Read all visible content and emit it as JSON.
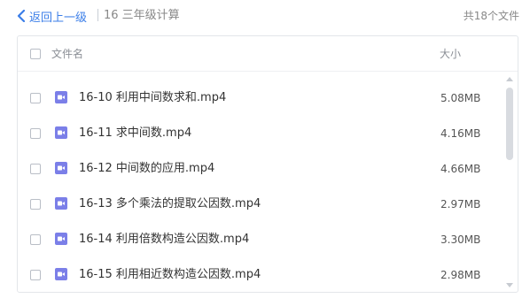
{
  "breadcrumb": {
    "back_label": "返回上一级",
    "current_folder": "16 三年级计算",
    "total_label": "共18个文件"
  },
  "file_list": {
    "header": {
      "name_label": "文件名",
      "size_label": "大小"
    },
    "icon": "video-file-icon",
    "accent_color": "#7b7fe8",
    "link_color": "#3b7ee8",
    "files": [
      {
        "name": "16-10 利用中间数求和.mp4",
        "size": "5.08MB"
      },
      {
        "name": "16-11 求中间数.mp4",
        "size": "4.16MB"
      },
      {
        "name": "16-12 中间数的应用.mp4",
        "size": "4.66MB"
      },
      {
        "name": "16-13 多个乘法的提取公因数.mp4",
        "size": "2.97MB"
      },
      {
        "name": "16-14 利用倍数构造公因数.mp4",
        "size": "3.30MB"
      },
      {
        "name": "16-15 利用相近数构造公因数.mp4",
        "size": "2.98MB"
      }
    ]
  }
}
